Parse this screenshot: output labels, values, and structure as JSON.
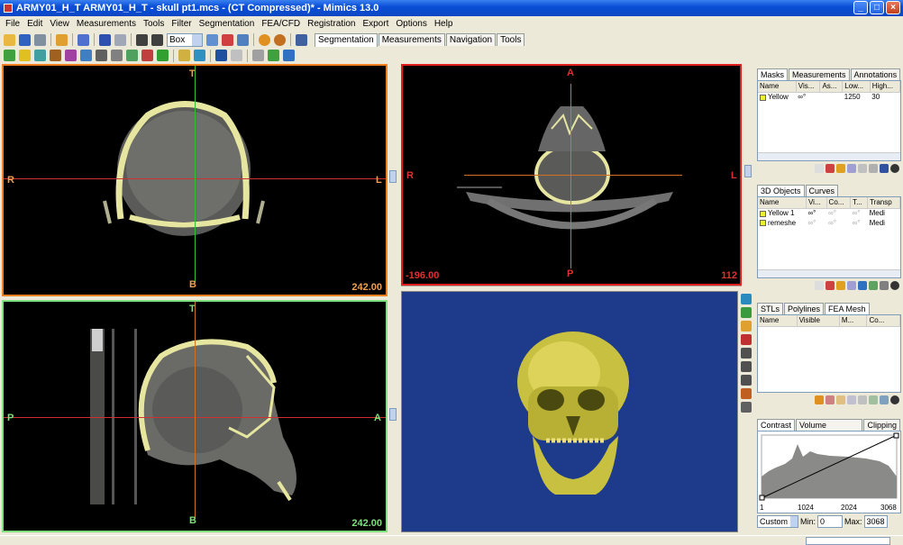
{
  "window": {
    "title": "ARMY01_H_T ARMY01_H_T - skull pt1.mcs - (CT Compressed)* - Mimics 13.0",
    "minimize": "_",
    "maximize": "□",
    "close": "×"
  },
  "menu": [
    "File",
    "Edit",
    "View",
    "Measurements",
    "Tools",
    "Filter",
    "Segmentation",
    "FEA/CFD",
    "Registration",
    "Export",
    "Options",
    "Help"
  ],
  "toolbar": {
    "select_value": "Box",
    "tabs": [
      "Segmentation",
      "Measurements",
      "Navigation",
      "Tools"
    ],
    "active_tab": "Segmentation"
  },
  "views": {
    "coronal": {
      "top": "T",
      "bottom": "B",
      "left": "R",
      "right": "L",
      "slice": "242.00",
      "border": "#f08020"
    },
    "axial": {
      "top": "A",
      "bottom": "P",
      "left": "R",
      "right": "L",
      "slice_left": "-196.00",
      "slice_right": "112",
      "border": "#e02020"
    },
    "sagittal": {
      "top": "T",
      "bottom": "B",
      "left": "P",
      "right": "A",
      "slice": "242.00",
      "border": "#80e080"
    },
    "render3d": {
      "bg": "#1e3a8a"
    }
  },
  "masks_panel": {
    "tabs": [
      "Masks",
      "Measurements",
      "Annotations"
    ],
    "active": "Masks",
    "columns": [
      "Name",
      "Vis...",
      "As...",
      "Low...",
      "High..."
    ],
    "rows": [
      {
        "name": "Yellow",
        "visible": "∞°",
        "assign": "",
        "low": "1250",
        "high": "30"
      }
    ]
  },
  "objects_panel": {
    "tabs": [
      "3D Objects",
      "Curves"
    ],
    "active": "3D Objects",
    "columns": [
      "Name",
      "Vi...",
      "Co...",
      "T...",
      "Transp"
    ],
    "rows": [
      {
        "name": "Yellow 1",
        "visible": "∞°",
        "contour": "∞°",
        "t": "∞°",
        "transp": "Medi"
      },
      {
        "name": "remeshe",
        "visible": "∞°",
        "contour": "∞°",
        "t": "∞°",
        "transp": "Medi"
      }
    ]
  },
  "stl_panel": {
    "tabs": [
      "STLs",
      "Polylines",
      "FEA Mesh"
    ],
    "active": "FEA Mesh",
    "columns": [
      "Name",
      "Visible",
      "M...",
      "Co..."
    ]
  },
  "contrast_panel": {
    "tabs": [
      "Contrast",
      "Volume Rendering",
      "Clipping"
    ],
    "active": "Contrast",
    "axis_labels": [
      "1",
      "1024",
      "2024",
      "3068"
    ],
    "preset": "Custom s",
    "min_label": "Min:",
    "min_value": "0",
    "max_label": "Max:",
    "max_value": "3068"
  }
}
